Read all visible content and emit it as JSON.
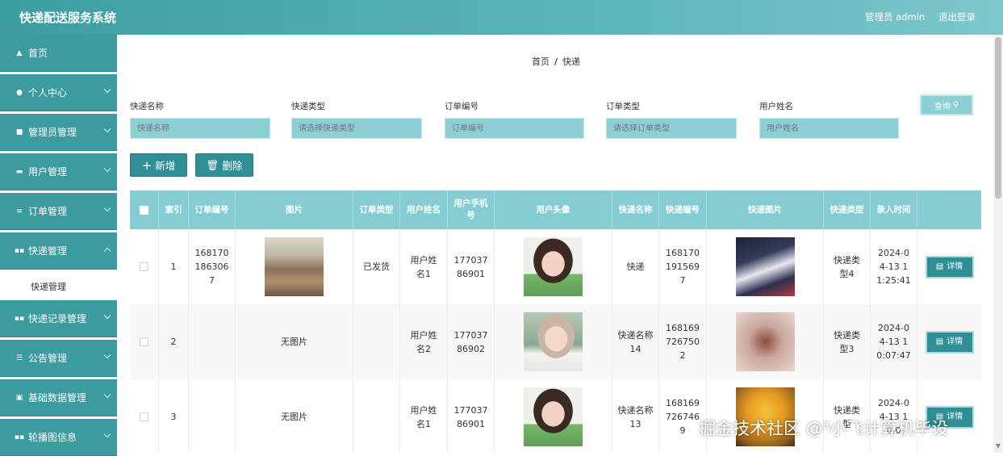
{
  "header": {
    "title": "快递配送服务系统",
    "user": "管理员 admin",
    "logout": "退出登录"
  },
  "sidebar": {
    "items": [
      {
        "label": "首页",
        "icon": "home-icon"
      },
      {
        "label": "个人中心",
        "icon": "user-icon"
      },
      {
        "label": "管理员管理",
        "icon": "admin-icon"
      },
      {
        "label": "用户管理",
        "icon": "monitor-icon"
      },
      {
        "label": "订单管理",
        "icon": "list-icon"
      },
      {
        "label": "快递管理",
        "icon": "grid-icon"
      },
      {
        "label": "快递记录管理",
        "icon": "grid-icon"
      },
      {
        "label": "公告管理",
        "icon": "lines-icon"
      },
      {
        "label": "基础数据管理",
        "icon": "doc-icon"
      },
      {
        "label": "轮播图信息",
        "icon": "grid-icon"
      }
    ],
    "sub_item": "快递管理"
  },
  "breadcrumb": {
    "home": "首页",
    "separator": "/",
    "current": "快递"
  },
  "filters": {
    "labels": [
      "快递名称",
      "快递类型",
      "订单编号",
      "订单类型",
      "用户姓名"
    ],
    "placeholders": [
      "快递名称",
      "请选择快递类型",
      "订单编号",
      "请选择订单类型",
      "用户姓名"
    ],
    "search_label": "查询"
  },
  "actions": {
    "add_label": "新增",
    "delete_label": "删除"
  },
  "table": {
    "headers": [
      "",
      "索引",
      "订单编号",
      "图片",
      "订单类型",
      "用户姓名",
      "用户手机号",
      "用户头像",
      "快递名称",
      "快递编号",
      "快递图片",
      "快递类型",
      "录入时间",
      ""
    ],
    "rows": [
      {
        "index": "1",
        "order_no": "1681701863067",
        "image": "photo-landscape",
        "order_type": "已发货",
        "user_name": "用户姓名1",
        "phone": "17703786901",
        "avatar": "photo-girl1",
        "express_name": "快递",
        "express_no": "1681701915697",
        "express_image": "photo-team",
        "express_type": "快递类型4",
        "time": "2024-04-13 11:25:41",
        "detail": "详情"
      },
      {
        "index": "2",
        "order_no": "",
        "image_text": "无图片",
        "order_type": "",
        "user_name": "用户姓名2",
        "phone": "17703786902",
        "avatar": "photo-girl2",
        "express_name": "快递名称14",
        "express_no": "1681697267502",
        "express_image": "photo-tree",
        "express_type": "快递类型3",
        "time": "2024-04-13 10:07:47",
        "detail": "详情"
      },
      {
        "index": "3",
        "order_no": "",
        "image_text": "无图片",
        "order_type": "",
        "user_name": "用户姓名1",
        "phone": "17703786901",
        "avatar": "photo-girl1",
        "express_name": "快递名称13",
        "express_no": "1681697267469",
        "express_image": "photo-autumn",
        "express_type": "快递类型",
        "time": "2024-04-13 10:0",
        "detail": "详情"
      }
    ]
  },
  "watermark": "掘金技术社区 @³小飞计算机毕设",
  "colors": {
    "header": "#3c9ea1",
    "sidebar": "#3b9b9f",
    "accent": "#2f8f94",
    "table_header": "#86cdd3"
  }
}
